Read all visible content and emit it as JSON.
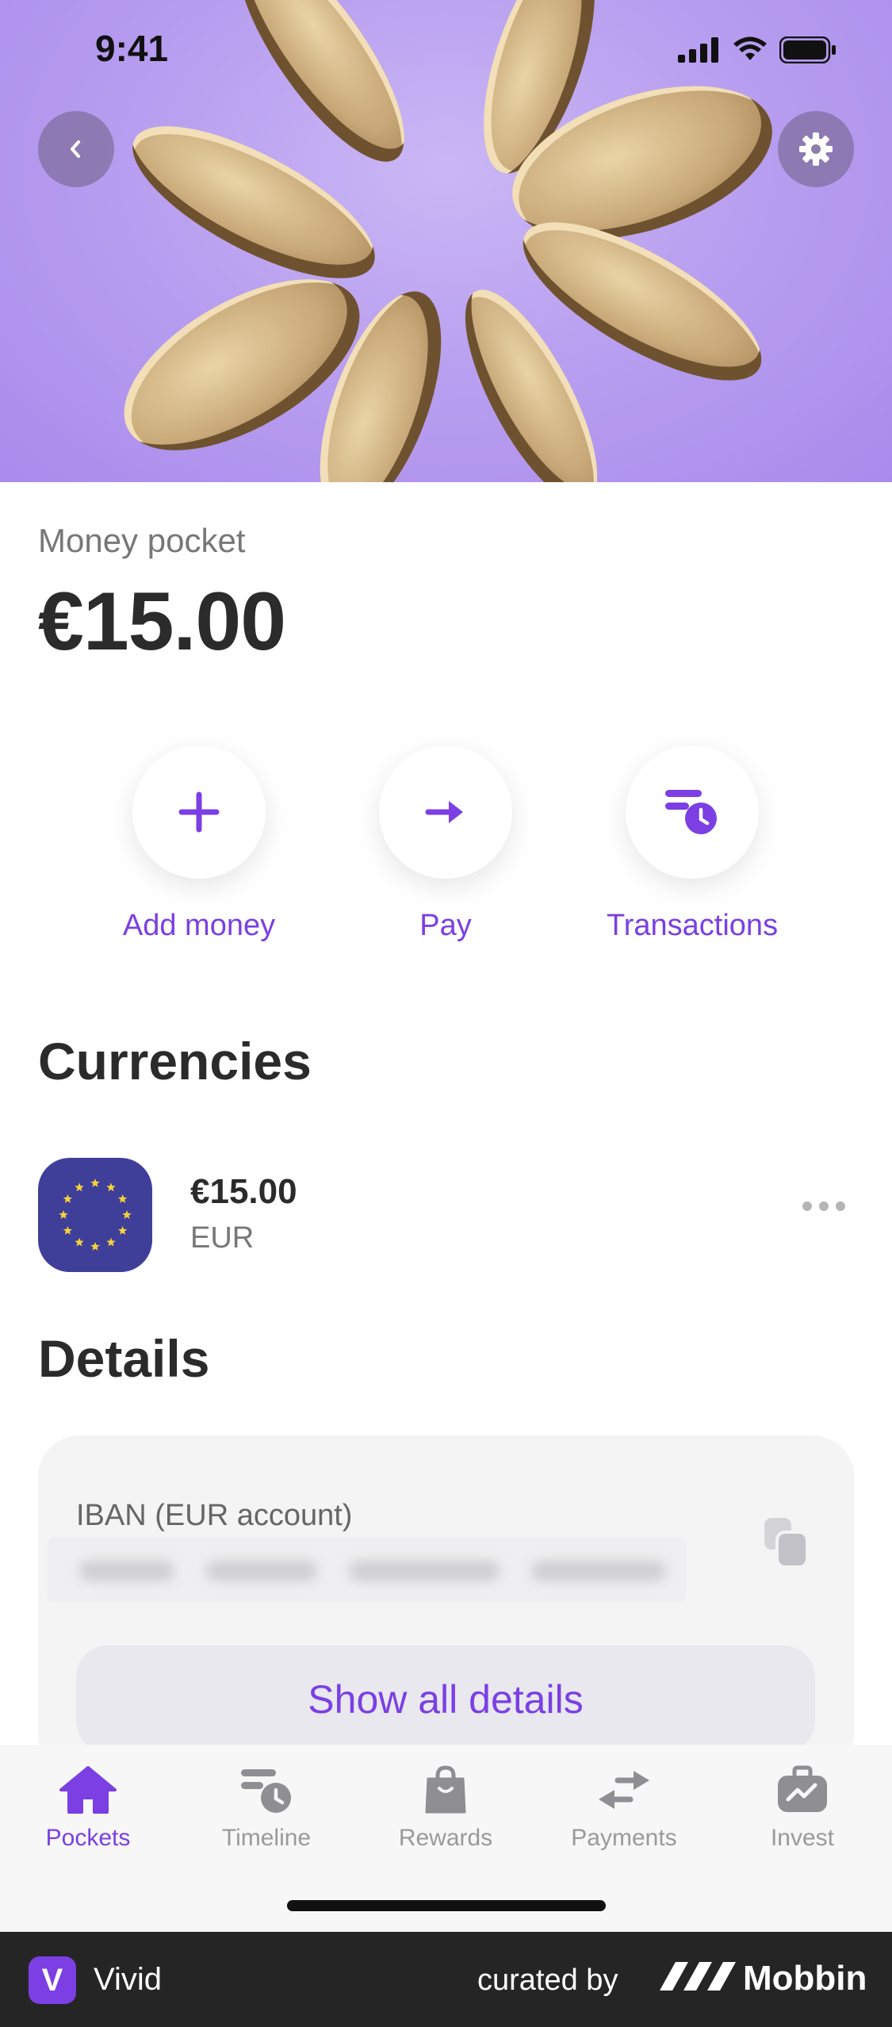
{
  "status_bar": {
    "time": "9:41"
  },
  "hero": {
    "back_icon": "chevron-left-icon",
    "settings_icon": "gear-icon"
  },
  "pocket": {
    "label": "Money pocket",
    "balance": "€15.00"
  },
  "actions": [
    {
      "label": "Add money",
      "icon": "plus-icon"
    },
    {
      "label": "Pay",
      "icon": "arrow-right-icon"
    },
    {
      "label": "Transactions",
      "icon": "transactions-clock-icon"
    }
  ],
  "currencies": {
    "title": "Currencies",
    "items": [
      {
        "amount": "€15.00",
        "code": "EUR",
        "icon": "eu-flag-icon"
      }
    ]
  },
  "details": {
    "title": "Details",
    "iban_label": "IBAN (EUR account)",
    "show_all": "Show all details"
  },
  "tabs": [
    {
      "label": "Pockets",
      "icon": "home-icon",
      "active": true
    },
    {
      "label": "Timeline",
      "icon": "timeline-icon",
      "active": false
    },
    {
      "label": "Rewards",
      "icon": "bag-icon",
      "active": false
    },
    {
      "label": "Payments",
      "icon": "transfer-icon",
      "active": false
    },
    {
      "label": "Invest",
      "icon": "briefcase-chart-icon",
      "active": false
    }
  ],
  "footer": {
    "app_name": "Vivid",
    "badge": "V",
    "curated_by": "curated by",
    "brand": "Mobbin"
  },
  "colors": {
    "accent": "#7b3fe4",
    "hero": "#b9a0f0",
    "footer": "#252526"
  }
}
